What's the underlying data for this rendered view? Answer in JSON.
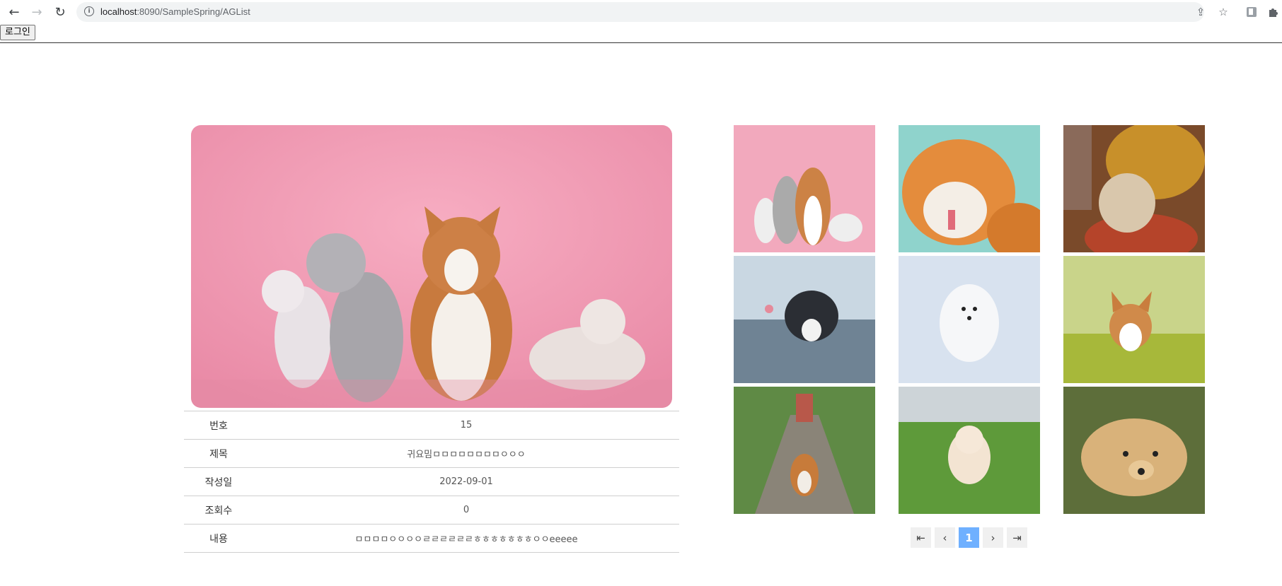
{
  "browser": {
    "url_host": "localhost",
    "url_rest": ":8090/SampleSpring/AGList"
  },
  "page": {
    "login_label": "로그인"
  },
  "detail": {
    "rows": [
      {
        "label": "번호",
        "value": "15"
      },
      {
        "label": "제목",
        "value": "귀요밈ㅁㅁㅁㅁㅁㅁㅁㅁㅇㅇㅇ"
      },
      {
        "label": "작성일",
        "value": "2022-09-01"
      },
      {
        "label": "조회수",
        "value": "0"
      },
      {
        "label": "내용",
        "value": "ㅁㅁㅁㅁㅇㅇㅇㅇㄹㄹㄹㄹㄹㄹㅎㅎㅎㅎㅎㅎㅎㅇㅇeeeee"
      }
    ]
  },
  "gallery": {
    "images": [
      "dogs-and-cats-pink-background",
      "orange-cat-licking",
      "tabby-kitten-in-pot",
      "black-white-kitten-on-cobblestone",
      "white-spitz-in-snow",
      "corgi-on-grass",
      "dog-on-railway-track",
      "poodle-puppy-on-lawn",
      "golden-puppy-lying"
    ]
  },
  "pagination": {
    "first": "⇤",
    "prev": "‹",
    "current": "1",
    "next": "›",
    "last": "⇥"
  },
  "colors": {
    "accent": "#6fb0ff",
    "pink_bg": "#f0a0b8"
  }
}
